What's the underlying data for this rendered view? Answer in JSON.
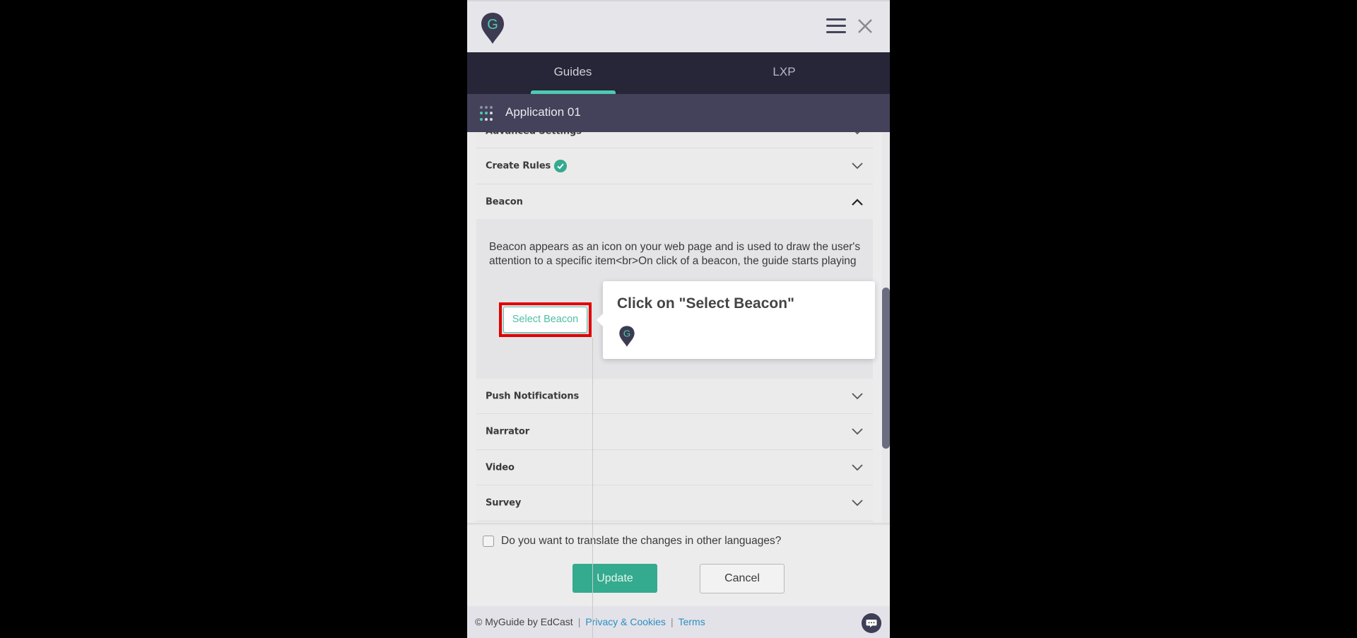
{
  "header": {
    "logo_icon": "myguide-pin-logo",
    "menu_icon": "hamburger-icon",
    "close_icon": "close-icon"
  },
  "tabs": [
    {
      "label": "Guides",
      "active": true
    },
    {
      "label": "LXP",
      "active": false
    }
  ],
  "app_bar": {
    "icon": "apps-grid-icon",
    "title": "Application 01"
  },
  "accordion": [
    {
      "title": "Advanced Settings",
      "expanded": false,
      "partially_visible": true
    },
    {
      "title": "Create Rules",
      "expanded": false,
      "completed": true
    },
    {
      "title": "Beacon",
      "expanded": true
    },
    {
      "title": "Push Notifications",
      "expanded": false
    },
    {
      "title": "Narrator",
      "expanded": false
    },
    {
      "title": "Video",
      "expanded": false
    },
    {
      "title": "Survey",
      "expanded": false
    }
  ],
  "beacon": {
    "description": "Beacon appears as an icon on your web page and is used to draw the user's attention to a specific item<br>On click of a beacon, the guide starts playing",
    "select_button_label": "Select Beacon"
  },
  "tooltip": {
    "title": "Click on \"Select Beacon\"",
    "icon": "myguide-pin-logo"
  },
  "translate": {
    "label": "Do you want to translate the changes in other languages?",
    "checked": false
  },
  "actions": {
    "update_label": "Update",
    "cancel_label": "Cancel"
  },
  "footer": {
    "copyright": "© MyGuide by EdCast",
    "privacy_link": "Privacy & Cookies",
    "terms_link": "Terms",
    "separator": "|",
    "chat_icon": "chat-bubble-icon"
  },
  "colors": {
    "accent": "#34aa8e",
    "tab_underline": "#4ecbb2",
    "tab_bar": "#262638",
    "app_bar": "#43425a",
    "highlight": "#e00000",
    "link": "#2a8fc4"
  }
}
